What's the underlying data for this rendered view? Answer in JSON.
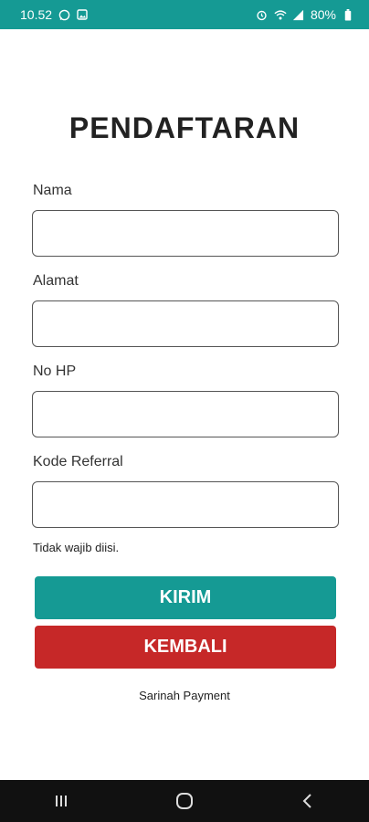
{
  "status_bar": {
    "time": "10.52",
    "battery": "80%",
    "icons": [
      "whatsapp-icon",
      "image-icon",
      "alarm-icon",
      "wifi-icon",
      "signal-icon",
      "battery-icon"
    ]
  },
  "form": {
    "title": "PENDAFTARAN",
    "fields": [
      {
        "label": "Nama",
        "value": "",
        "placeholder": ""
      },
      {
        "label": "Alamat",
        "value": "",
        "placeholder": ""
      },
      {
        "label": "No HP",
        "value": "",
        "placeholder": ""
      },
      {
        "label": "Kode Referral",
        "value": "",
        "placeholder": ""
      }
    ],
    "hint": "Tidak wajib diisi."
  },
  "buttons": {
    "submit": "KIRIM",
    "back": "KEMBALI"
  },
  "footer": "Sarinah Payment",
  "navigation": [
    "recent-apps-icon",
    "home-icon",
    "back-icon"
  ],
  "colors": {
    "primary": "#159a94",
    "danger": "#c62828",
    "navbar": "#111111"
  }
}
